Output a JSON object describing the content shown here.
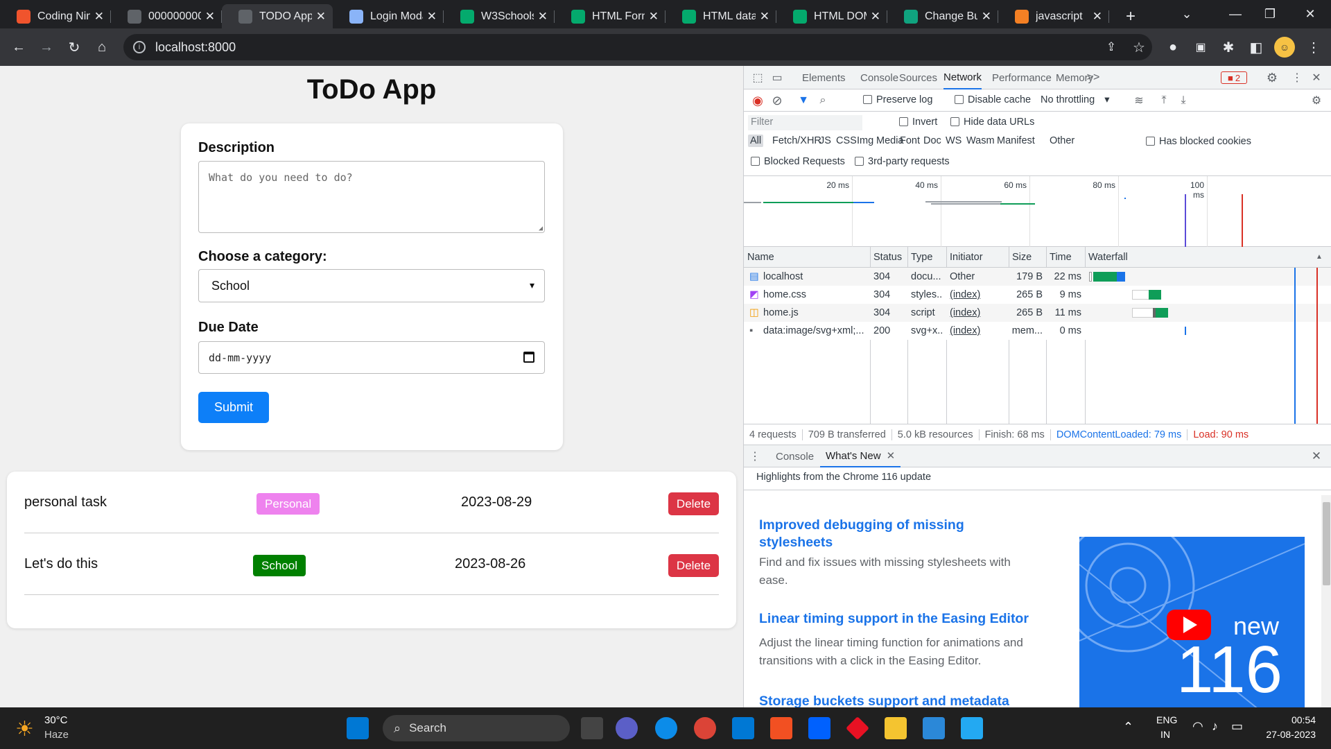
{
  "browser": {
    "tabs": [
      {
        "title": "Coding Nin",
        "icon": "coding-ninjas-icon",
        "color": "#f0542d"
      },
      {
        "title": "0000000000",
        "icon": "globe-icon",
        "color": "#5f6368"
      },
      {
        "title": "TODO App",
        "icon": "globe-icon",
        "color": "#5f6368",
        "active": true
      },
      {
        "title": "Login Moda",
        "icon": "page-icon",
        "color": "#8ab4f8"
      },
      {
        "title": "W3Schools",
        "icon": "w3schools-icon",
        "color": "#04aa6d"
      },
      {
        "title": "HTML Form",
        "icon": "w3schools-icon",
        "color": "#04aa6d"
      },
      {
        "title": "HTML data",
        "icon": "w3schools-icon",
        "color": "#04aa6d"
      },
      {
        "title": "HTML DOM",
        "icon": "w3schools-icon",
        "color": "#04aa6d"
      },
      {
        "title": "Change Bu",
        "icon": "chatgpt-icon",
        "color": "#10a37f"
      },
      {
        "title": "javascript",
        "icon": "stackoverflow-icon",
        "color": "#f48024"
      }
    ],
    "new_tab": "+",
    "url": "localhost:8000"
  },
  "app": {
    "title": "ToDo App",
    "form": {
      "description_label": "Description",
      "description_placeholder": "What do you need to do?",
      "category_label": "Choose a category:",
      "category_value": "School",
      "due_label": "Due Date",
      "due_placeholder": "dd-mm-yyyy",
      "submit_label": "Submit"
    },
    "todos": [
      {
        "name": "personal task",
        "category": "Personal",
        "category_color": "#ee82ee",
        "date": "2023-08-29",
        "delete_label": "Delete"
      },
      {
        "name": "Let's do this",
        "category": "School",
        "category_color": "#008000",
        "date": "2023-08-26",
        "delete_label": "Delete"
      }
    ]
  },
  "devtools": {
    "tabs": [
      "Elements",
      "Console",
      "Sources",
      "Network",
      "Performance",
      "Memory"
    ],
    "active_tab": "Network",
    "more": ">>",
    "error_count": "2",
    "toolbar": {
      "preserve_log": "Preserve log",
      "disable_cache": "Disable cache",
      "throttling": "No throttling"
    },
    "filter": {
      "placeholder": "Filter",
      "invert": "Invert",
      "hide_data_urls": "Hide data URLs",
      "types": [
        "All",
        "Fetch/XHR",
        "JS",
        "CSS",
        "Img",
        "Media",
        "Font",
        "Doc",
        "WS",
        "Wasm",
        "Manifest",
        "Other"
      ],
      "has_blocked_cookies": "Has blocked cookies",
      "blocked_requests": "Blocked Requests",
      "third_party": "3rd-party requests"
    },
    "overview_ticks": [
      "20 ms",
      "40 ms",
      "60 ms",
      "80 ms",
      "100 ms"
    ],
    "columns": [
      "Name",
      "Status",
      "Type",
      "Initiator",
      "Size",
      "Time",
      "Waterfall"
    ],
    "requests": [
      {
        "name": "localhost",
        "status": "304",
        "type": "docu...",
        "initiator": "Other",
        "size": "179 B",
        "time": "22 ms",
        "icon": "document-icon"
      },
      {
        "name": "home.css",
        "status": "304",
        "type": "styles...",
        "initiator": "(index)",
        "size": "265 B",
        "time": "9 ms",
        "icon": "stylesheet-icon"
      },
      {
        "name": "home.js",
        "status": "304",
        "type": "script",
        "initiator": "(index)",
        "size": "265 B",
        "time": "11 ms",
        "icon": "script-icon"
      },
      {
        "name": "data:image/svg+xml;...",
        "status": "200",
        "type": "svg+x...",
        "initiator": "(index)",
        "size": "(mem...",
        "time": "0 ms",
        "icon": "image-icon"
      }
    ],
    "summary": {
      "requests": "4 requests",
      "transferred": "709 B transferred",
      "resources": "5.0 kB resources",
      "finish": "Finish: 68 ms",
      "dcl": "DOMContentLoaded: 79 ms",
      "load": "Load: 90 ms"
    },
    "drawer": {
      "tabs": [
        "Console",
        "What's New"
      ],
      "active_tab": "What's New",
      "highlight": "Highlights from the Chrome 116 update",
      "items": [
        {
          "title": "Improved debugging of missing stylesheets",
          "text": "Find and fix issues with missing stylesheets with ease."
        },
        {
          "title": "Linear timing support in the Easing Editor",
          "text": "Adjust the linear timing function for animations and transitions with a click in the Easing Editor."
        },
        {
          "title": "Storage buckets support and metadata",
          "text": ""
        }
      ],
      "thumb_new": "new",
      "thumb_version": "116"
    }
  },
  "taskbar": {
    "weather_temp": "30°C",
    "weather_desc": "Haze",
    "search_label": "Search",
    "lang_1": "ENG",
    "lang_2": "IN",
    "time": "00:54",
    "date": "27-08-2023"
  }
}
